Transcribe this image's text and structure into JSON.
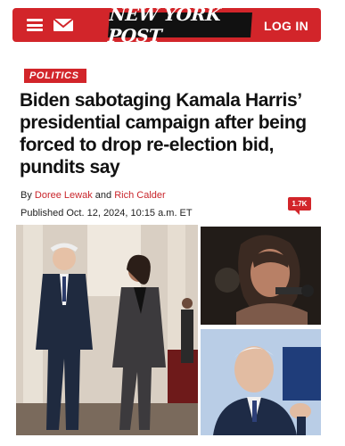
{
  "header": {
    "logo_text": "NEW YORK POST",
    "login_label": "LOG IN",
    "brand_color": "#d2252a",
    "menu_icon": "hamburger-icon",
    "mail_icon": "mail-icon"
  },
  "article": {
    "category": "POLITICS",
    "headline": "Biden sabotaging Kamala Harris’ presidential campaign after being forced to drop re-election bid, pundits say",
    "byline_prefix": "By",
    "author_1": "Doree Lewak",
    "byline_and": "and",
    "author_2": "Rich Calder",
    "published": "Published Oct. 12, 2024, 10:15 a.m. ET",
    "comment_count": "1.7K"
  },
  "images": {
    "main": "photo-biden-harris-walking",
    "top_right": "photo-harris-portrait",
    "bottom_right": "photo-biden-speaking"
  }
}
